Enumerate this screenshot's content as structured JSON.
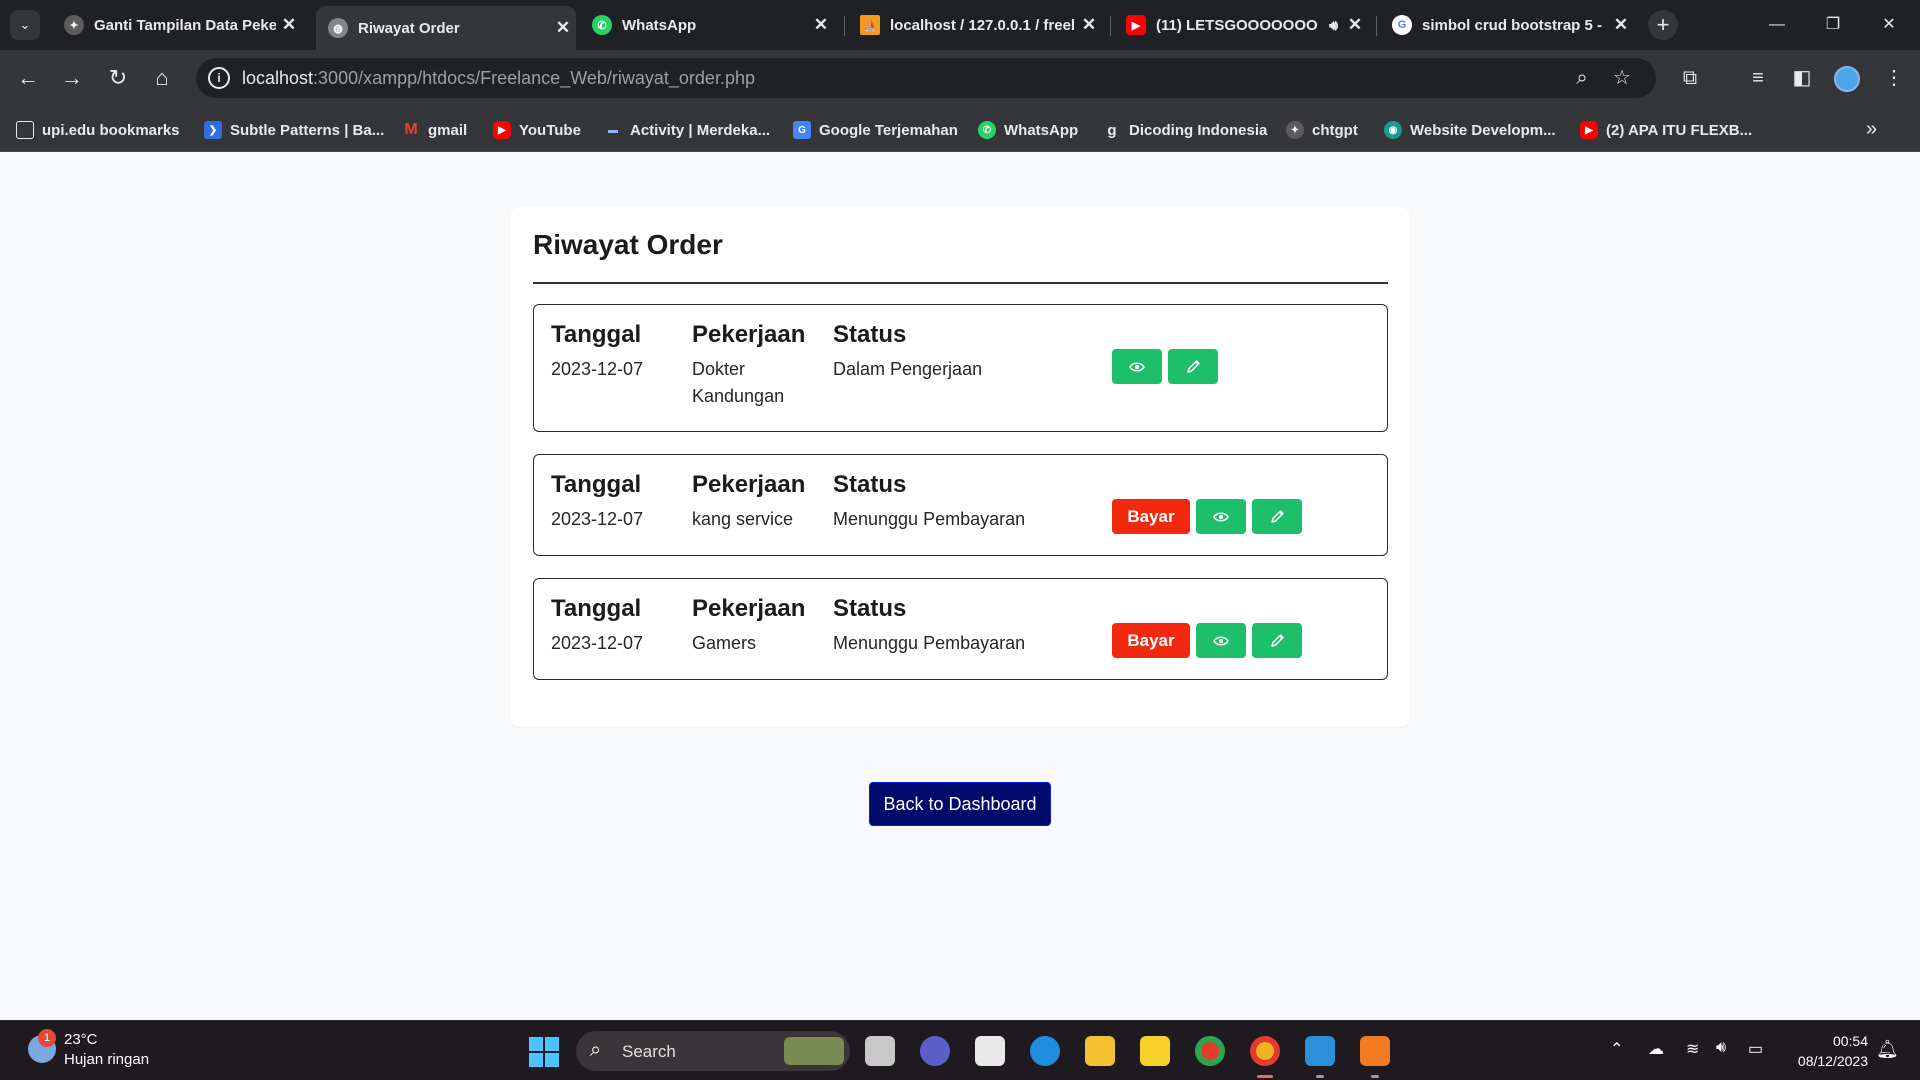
{
  "browser": {
    "tabs": [
      {
        "title": "Ganti Tampilan Data Peker",
        "favicon": "chatgpt-icon",
        "active": false
      },
      {
        "title": "Riwayat Order",
        "favicon": "globe-icon",
        "active": true
      },
      {
        "title": "WhatsApp",
        "favicon": "whatsapp-icon",
        "active": false
      },
      {
        "title": "localhost / 127.0.0.1 / freel",
        "favicon": "phpmyadmin-icon",
        "active": false
      },
      {
        "title": "(11) LETSGOOOOOOO",
        "favicon": "youtube-icon",
        "active": false
      },
      {
        "title": "simbol crud bootstrap 5 -",
        "favicon": "google-icon",
        "active": false
      }
    ],
    "url_host": "localhost",
    "url_path": ":3000/xampp/htdocs/Freelance_Web/riwayat_order.php",
    "bookmarks": [
      {
        "label": "upi.edu bookmarks",
        "icon": "folder-icon"
      },
      {
        "label": "Subtle Patterns | Ba...",
        "icon": "subtle-patterns-icon"
      },
      {
        "label": "gmail",
        "icon": "gmail-icon"
      },
      {
        "label": "YouTube",
        "icon": "youtube-icon"
      },
      {
        "label": "Activity | Merdeka...",
        "icon": "merdeka-icon"
      },
      {
        "label": "Google Terjemahan",
        "icon": "google-translate-icon"
      },
      {
        "label": "WhatsApp",
        "icon": "whatsapp-icon"
      },
      {
        "label": "Dicoding Indonesia",
        "icon": "dicoding-icon"
      },
      {
        "label": "chtgpt",
        "icon": "chatgpt-icon"
      },
      {
        "label": "Website Developm...",
        "icon": "website-icon"
      },
      {
        "label": "(2) APA ITU FLEXB...",
        "icon": "youtube-icon"
      }
    ]
  },
  "page": {
    "title": "Riwayat Order",
    "columns": {
      "date": "Tanggal",
      "job": "Pekerjaan",
      "status": "Status"
    },
    "orders": [
      {
        "date": "2023-12-07",
        "job": "Dokter Kandungan",
        "status": "Dalam Pengerjaan",
        "pay_label": ""
      },
      {
        "date": "2023-12-07",
        "job": "kang service",
        "status": "Menunggu Pembayaran",
        "pay_label": "Bayar"
      },
      {
        "date": "2023-12-07",
        "job": "Gamers",
        "status": "Menunggu Pembayaran",
        "pay_label": "Bayar"
      }
    ],
    "back_button": "Back to Dashboard",
    "colors": {
      "pay": "#f2280f",
      "action": "#1ebf6b",
      "back": "#000a6b"
    }
  },
  "taskbar": {
    "weather_temp": "23°C",
    "weather_desc": "Hujan ringan",
    "weather_badge": "1",
    "search_label": "Search",
    "time": "00:54",
    "date": "08/12/2023"
  }
}
